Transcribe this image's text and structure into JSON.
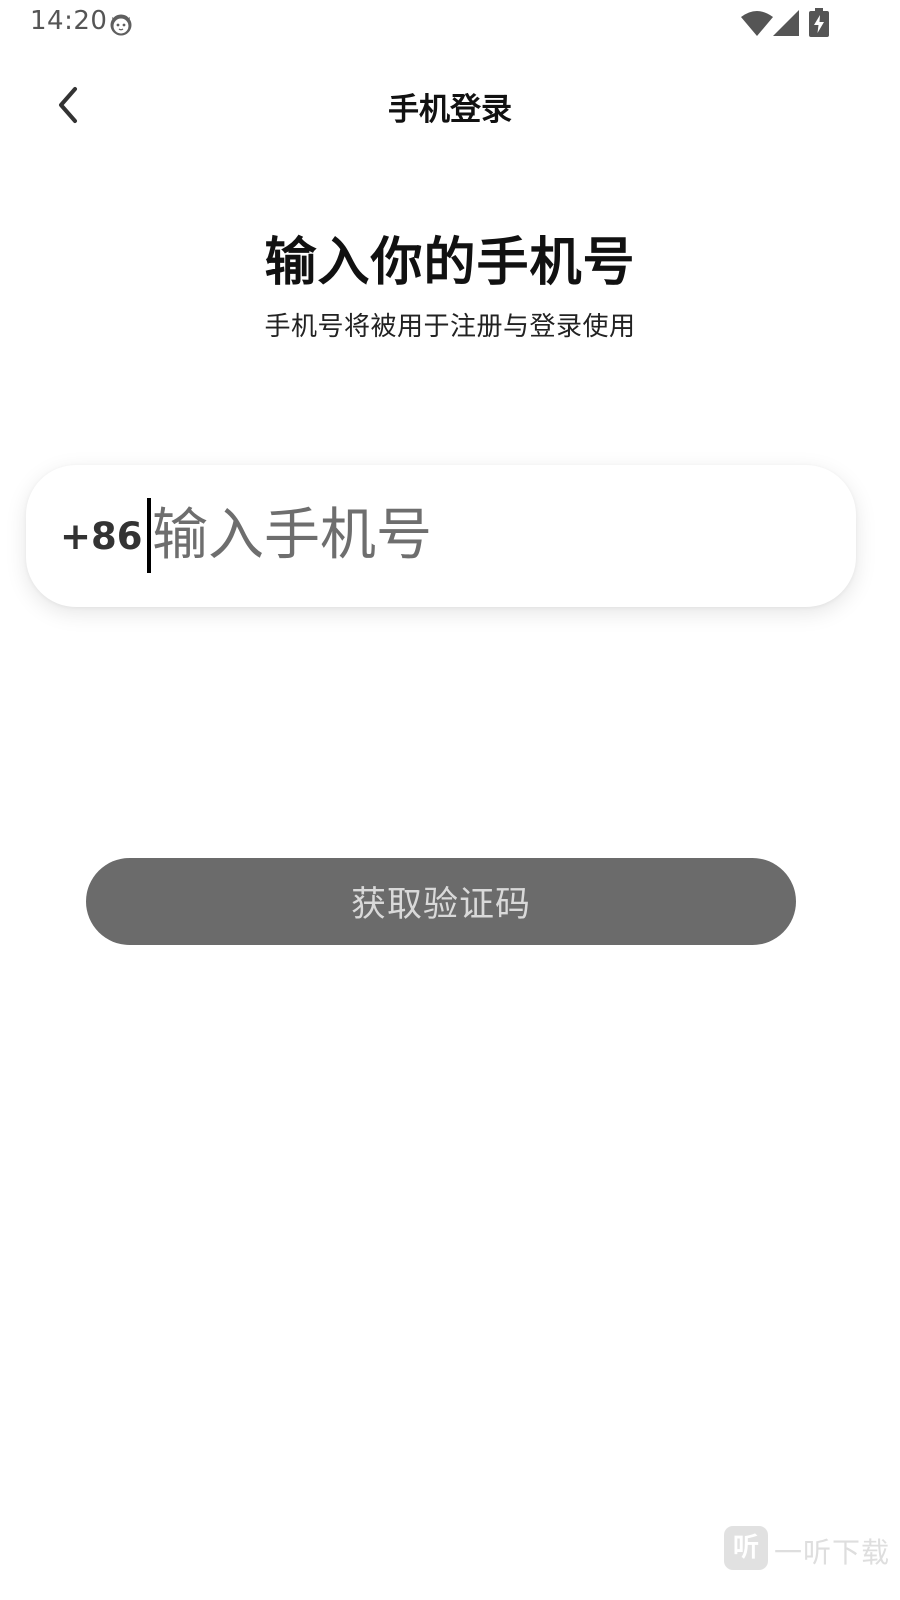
{
  "status_bar": {
    "time": "14:20",
    "icons": [
      "cat-face-icon",
      "wifi-icon",
      "cellular-signal-icon",
      "battery-charging-icon"
    ]
  },
  "app_bar": {
    "back_icon": "chevron-left-icon",
    "title": "手机登录"
  },
  "main": {
    "heading": "输入你的手机号",
    "subheading": "手机号将被用于注册与登录使用",
    "phone_input": {
      "country_code": "+86",
      "placeholder": "输入手机号",
      "value": ""
    },
    "get_code_button": "获取验证码"
  },
  "watermark": {
    "logo_char": "听",
    "text": "一听下载"
  },
  "colors": {
    "button_bg": "#6b6b6b",
    "button_text": "#d9d9d9",
    "title_text": "#111111",
    "placeholder": "#6e6e6e"
  }
}
